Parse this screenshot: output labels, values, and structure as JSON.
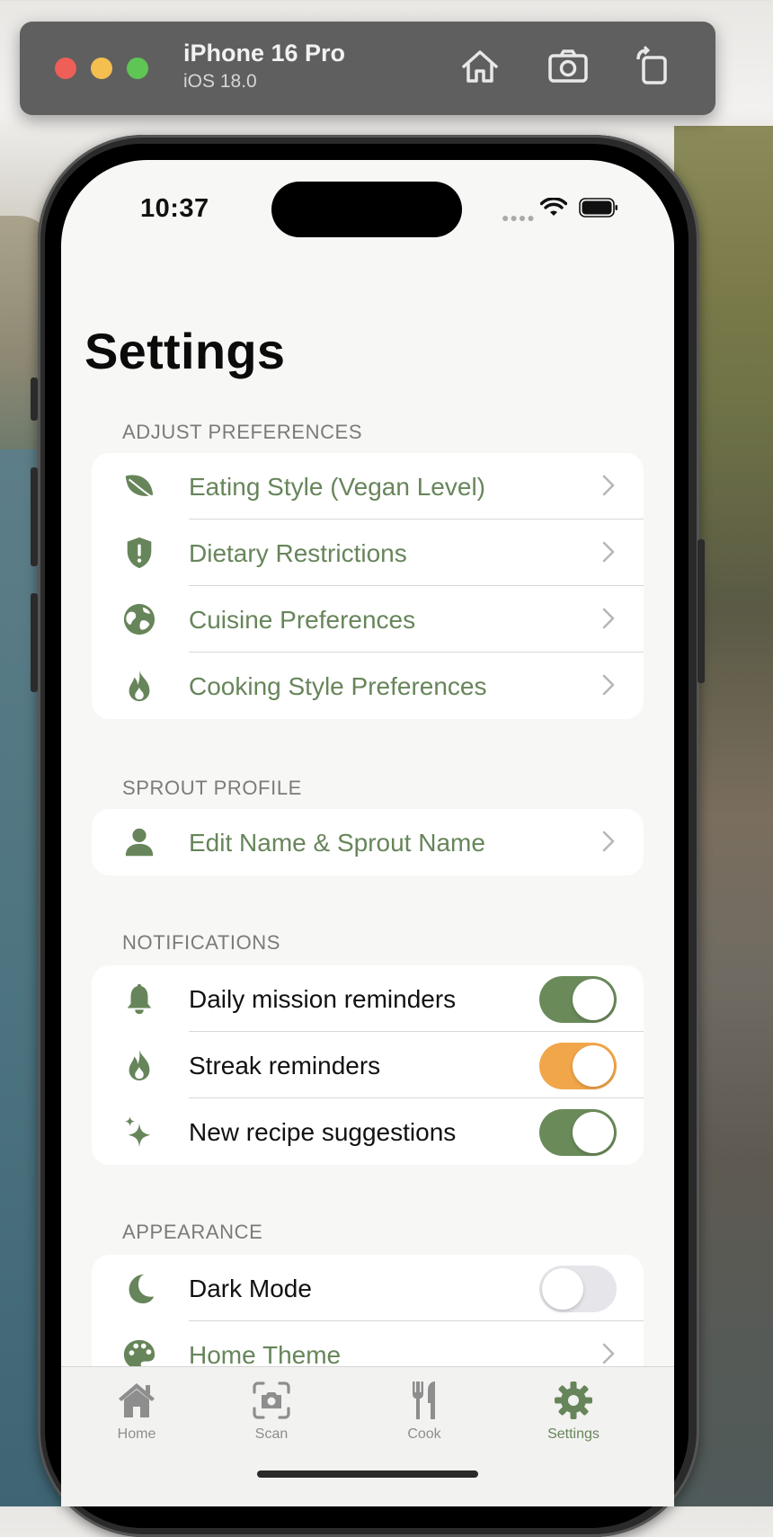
{
  "simulator": {
    "device_name": "iPhone 16 Pro",
    "os_version": "iOS 18.0"
  },
  "status_bar": {
    "time": "10:37"
  },
  "page": {
    "title": "Settings"
  },
  "sections": {
    "preferences": {
      "header": "ADJUST PREFERENCES",
      "items": [
        {
          "label": "Eating Style (Vegan Level)",
          "icon": "leaf-icon"
        },
        {
          "label": "Dietary Restrictions",
          "icon": "shield-exclamation-icon"
        },
        {
          "label": "Cuisine Preferences",
          "icon": "globe-icon"
        },
        {
          "label": "Cooking Style Preferences",
          "icon": "flame-icon"
        }
      ]
    },
    "profile": {
      "header": "SPROUT PROFILE",
      "items": [
        {
          "label": "Edit Name & Sprout Name",
          "icon": "person-icon"
        }
      ]
    },
    "notifications": {
      "header": "NOTIFICATIONS",
      "items": [
        {
          "label": "Daily mission reminders",
          "icon": "bell-icon",
          "enabled": true
        },
        {
          "label": "Streak reminders",
          "icon": "flame-icon",
          "enabled": true
        },
        {
          "label": "New recipe suggestions",
          "icon": "sparkles-icon",
          "enabled": true
        }
      ]
    },
    "appearance": {
      "header": "APPEARANCE",
      "items": [
        {
          "label": "Dark Mode",
          "icon": "moon-icon",
          "enabled": false
        },
        {
          "label": "Home Theme",
          "icon": "palette-icon"
        }
      ]
    }
  },
  "tab_bar": {
    "tabs": [
      {
        "label": "Home",
        "icon": "house-icon",
        "selected": false
      },
      {
        "label": "Scan",
        "icon": "camera-scan-icon",
        "selected": false
      },
      {
        "label": "Cook",
        "icon": "fork-knife-icon",
        "selected": false
      },
      {
        "label": "Settings",
        "icon": "gear-icon",
        "selected": true
      }
    ]
  },
  "colors": {
    "accent_green": "#67855a",
    "toggle_green": "#6a8a5a",
    "streak_orange": "#f2a64a",
    "toggle_off": "#e5e5ea",
    "tab_inactive": "#8e8e8e"
  }
}
